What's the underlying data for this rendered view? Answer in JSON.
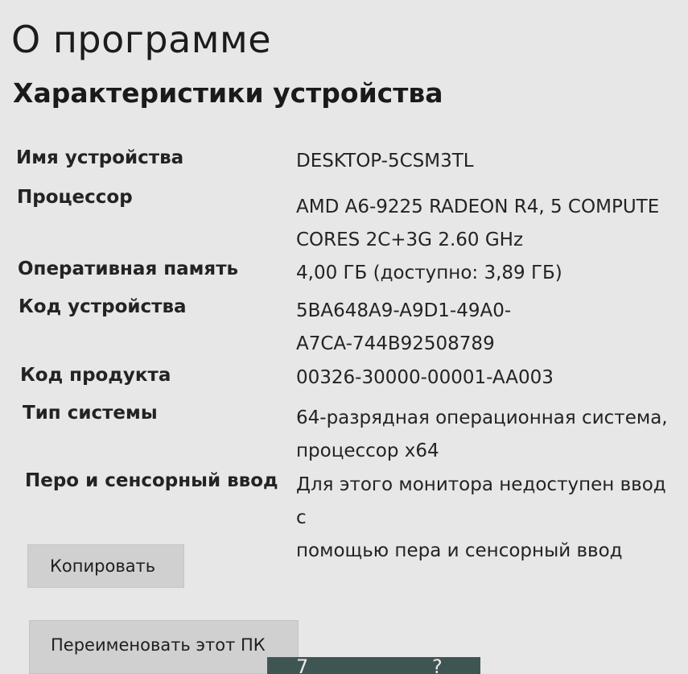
{
  "page": {
    "title": "О программе",
    "section_title": "Характеристики устройства"
  },
  "specs": [
    {
      "label": "Имя устройства",
      "value": "DESKTOP-5CSM3TL"
    },
    {
      "label": "Процессор",
      "value": "AMD A6-9225 RADEON R4, 5 COMPUTE\nCORES 2C+3G      2.60 GHz"
    },
    {
      "label": "Оперативная память",
      "value": "4,00 ГБ (доступно: 3,89 ГБ)"
    },
    {
      "label": "Код устройства",
      "value": "5BA648A9-A9D1-49A0-\nA7CA-744B92508789"
    },
    {
      "label": "Код продукта",
      "value": "00326-30000-00001-AA003"
    },
    {
      "label": "Тип системы",
      "value": "64-разрядная операционная система,\nпроцессор x64"
    },
    {
      "label": "Перо и сенсорный ввод",
      "value": "Для этого монитора недоступен ввод с\nпомощью пера и сенсорный ввод"
    }
  ],
  "buttons": {
    "copy": "Копировать",
    "rename": "Переименовать этот ПК"
  },
  "taskbar": {
    "glyphs": [
      "7",
      "?"
    ]
  }
}
